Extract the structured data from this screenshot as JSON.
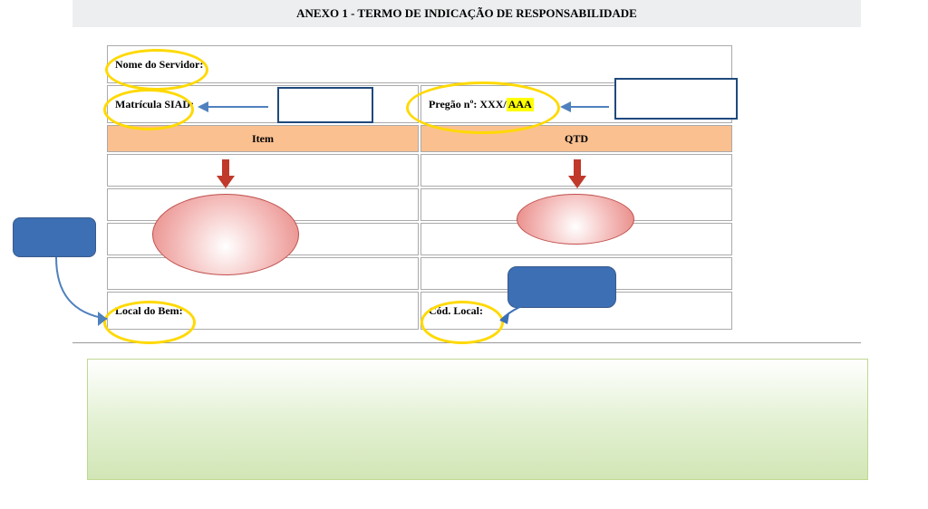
{
  "header": {
    "title": "ANEXO 1 -  TERMO DE INDICAÇÃO DE RESPONSABILIDADE"
  },
  "form": {
    "nome_servidor_label": "Nome do Servidor:",
    "matricula_label": "Matrícula SIAD:",
    "pregao_prefix": "Pregão nº: XXX/",
    "pregao_suffix": "AAA",
    "item_header": "Item",
    "qtd_header": "QTD",
    "local_bem_label": "Local do Bem:",
    "cod_local_label": "Cód. Local:"
  }
}
